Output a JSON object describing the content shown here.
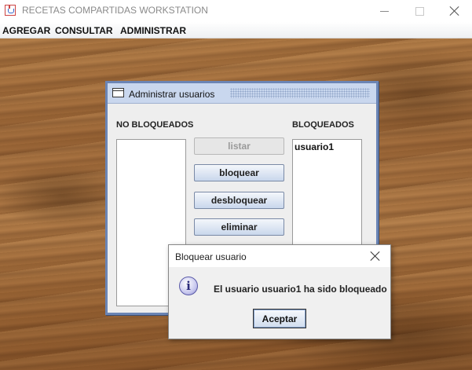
{
  "window": {
    "title": "RECETAS COMPARTIDAS WORKSTATION",
    "icon": "java-cup-icon"
  },
  "menubar": {
    "items": [
      "AGREGAR",
      "CONSULTAR",
      "ADMINISTRAR"
    ]
  },
  "internal_frame": {
    "title": "Administrar usuarios",
    "left_label": "NO BLOQUEADOS",
    "right_label": "BLOQUEADOS",
    "unblocked_users": [],
    "blocked_users": [
      "usuario1"
    ],
    "buttons": {
      "list": "listar",
      "block": "bloquear",
      "unblock": "desbloquear",
      "delete": "eliminar"
    }
  },
  "dialog": {
    "title": "Bloquear usuario",
    "message": "El usuario usuario1 ha sido bloqueado",
    "ok_label": "Aceptar",
    "icon": "info-icon"
  },
  "colors": {
    "frame_border": "#6b85b5",
    "frame_title_bg": "#c9d7ee"
  }
}
